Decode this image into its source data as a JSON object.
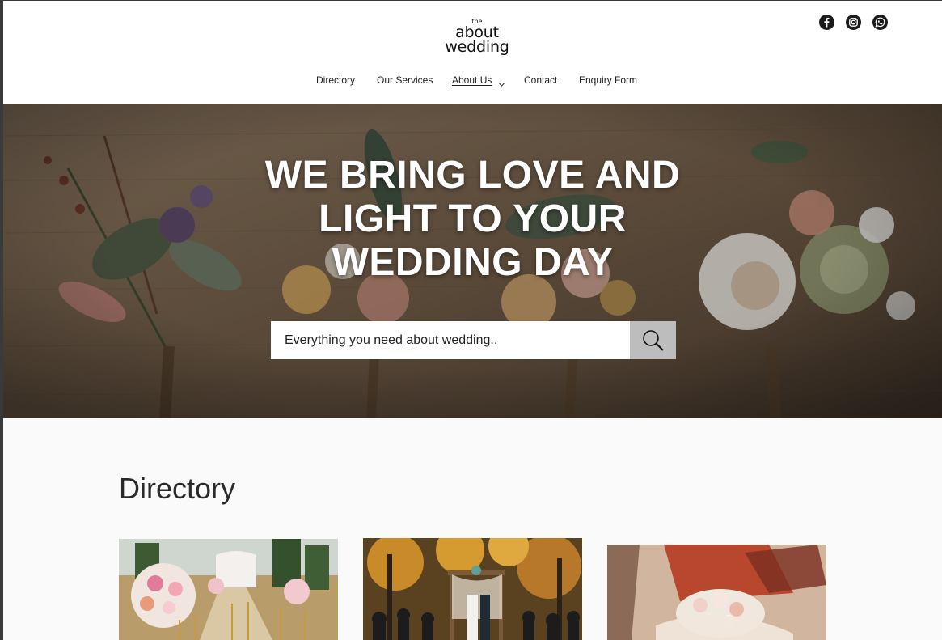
{
  "brand": {
    "logo_the": "the",
    "logo_about": "about",
    "logo_wedding": "wedding"
  },
  "social": [
    {
      "name": "facebook-icon"
    },
    {
      "name": "instagram-icon"
    },
    {
      "name": "whatsapp-icon"
    }
  ],
  "nav": {
    "items": [
      {
        "label": "Directory"
      },
      {
        "label": "Our Services"
      },
      {
        "label": "About Us",
        "active": true,
        "has_dropdown": true
      },
      {
        "label": "Contact"
      },
      {
        "label": "Enquiry Form"
      }
    ]
  },
  "hero": {
    "title_line1": "WE BRING LOVE AND",
    "title_line2": "LIGHT TO YOUR",
    "title_line3": "WEDDING DAY",
    "search_placeholder": "Everything you need about wedding.."
  },
  "directory": {
    "title": "Directory",
    "cards": [
      {
        "name": "card-floral-aisle"
      },
      {
        "name": "card-outdoor-ceremony"
      },
      {
        "name": "card-bouquet"
      }
    ]
  },
  "colors": {
    "header_bg": "#ffffff",
    "section_bg": "#fafafa",
    "search_button": "#bdbdbd",
    "text_dark": "#222222"
  }
}
